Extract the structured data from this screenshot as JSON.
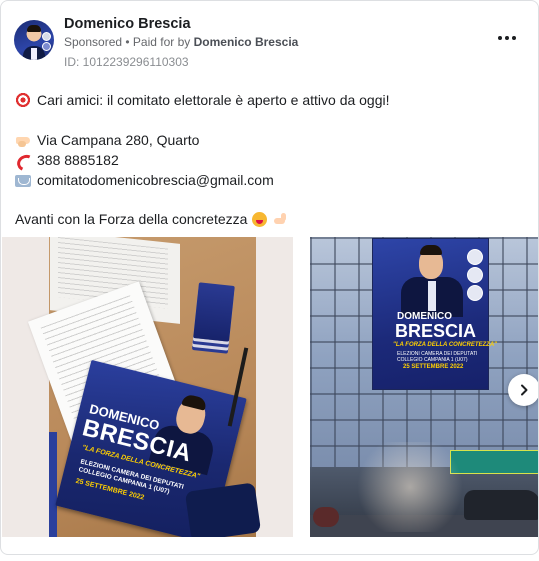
{
  "ad": {
    "page_name": "Domenico Brescia",
    "sponsored_label": "Sponsored",
    "separator": " • ",
    "paid_for_prefix": "Paid for by ",
    "paid_for_name": "Domenico Brescia",
    "library_id": "ID: 1012239296110303"
  },
  "post": {
    "line1": "Cari amici: il comitato elettorale è aperto e attivo da oggi!",
    "address": "Via Campana 280, Quarto",
    "phone": "388 8885182",
    "email": "comitatodomenicobrescia@gmail.com",
    "closing": "Avanti con la Forza della concretezza"
  },
  "icons": {
    "line1": "direct-hit-target-emoji",
    "address": "pointing-hand-emoji",
    "phone": "telephone-receiver-emoji",
    "email": "envelope-emoji",
    "closing_1": "smiling-face-emoji",
    "closing_2": "flexed-biceps-emoji",
    "menu": "more-options-icon",
    "next": "chevron-right-icon"
  },
  "carousel": {
    "photo1": {
      "flyer_name1": "DOMENICO",
      "flyer_name2": "BRESCIA",
      "flyer_slogan": "\"LA FORZA DELLA CONCRETEZZA\"",
      "flyer_sub1": "ELEZIONI CAMERA DEI DEPUTATI",
      "flyer_sub2": "COLLEGIO CAMPANIA 1 (U07)",
      "flyer_date": "25 SETTEMBRE 2022"
    },
    "photo2": {
      "banner_name1": "DOMENICO",
      "banner_name2": "BRESCIA",
      "banner_slogan": "\"LA FORZA DELLA CONCRETEZZA\"",
      "banner_sub1": "ELEZIONI CAMERA DEI DEPUTATI",
      "banner_sub2": "COLLEGIO CAMPANIA 1 (U07)",
      "banner_date": "25 SETTEMBRE 2022"
    }
  },
  "colors": {
    "text_primary": "#1c1e21",
    "text_secondary": "#65676b",
    "campaign_blue": "#1c2a7a",
    "campaign_yellow": "#ffd000"
  }
}
